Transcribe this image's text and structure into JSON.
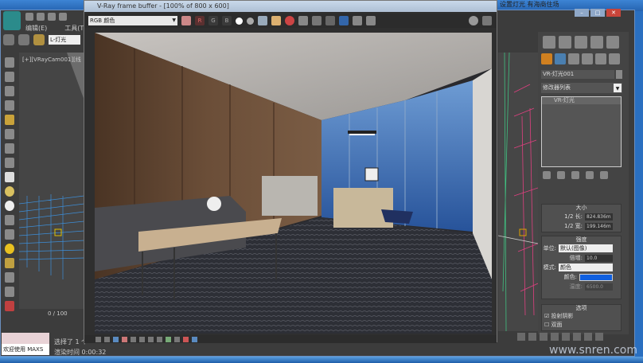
{
  "max": {
    "menu": [
      "编辑(E)",
      "工具(T)"
    ],
    "selection_set": "L-灯光",
    "viewport_label": "[+][VRayCam001][线",
    "right_title": "设置灯光 有海商住场",
    "timeline": "0 / 100",
    "timeline_end": "100",
    "status_selected": "选择了 1 个",
    "render_time": "渲染时间 0:00:32",
    "welcome": "欢迎使用 MAXS",
    "watermark": "www.snren.com"
  },
  "vfb": {
    "title": "V-Ray frame buffer - [100% of 800 x 600]",
    "channel": "RGB 颜色",
    "buttons": [
      "R",
      "G",
      "B"
    ]
  },
  "command_panel": {
    "object_name": "VR-灯光001",
    "modifier_list": "修改器列表",
    "stack_item": "VR-灯光",
    "size": {
      "title": "大小",
      "half_length_label": "1/2 长:",
      "half_length": "824.836m",
      "half_width_label": "1/2 宽:",
      "half_width": "199.146m"
    },
    "intensity": {
      "title": "强度",
      "units_label": "单位:",
      "units": "默认(图像)",
      "multiplier_label": "倍增:",
      "multiplier": "10.0",
      "mode_label": "模式:",
      "mode": "颜色",
      "color_label": "颜色:",
      "color": "#1060e0",
      "temp_label": "温度:",
      "temp": "6500.0"
    },
    "options": {
      "title": "选项",
      "cast_shadows": "投射阴影",
      "cast_shadows_checked": true,
      "double_sided": "双面",
      "double_sided_checked": false
    }
  }
}
